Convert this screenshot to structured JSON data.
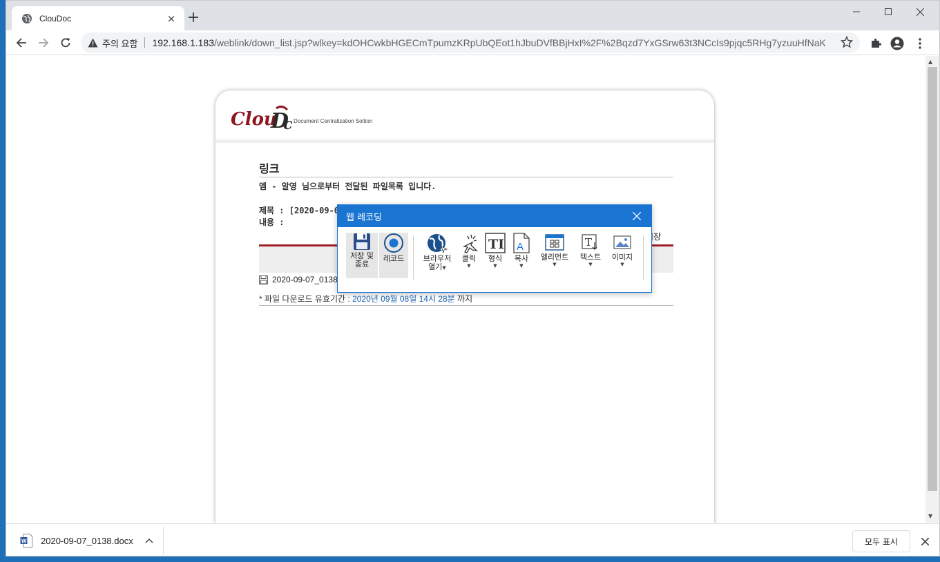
{
  "browser": {
    "tab_title": "ClouDoc",
    "tab_close": "×",
    "new_tab": "+",
    "security_warning": "주의 요함",
    "url_host": "192.168.1.183",
    "url_path": "/weblink/down_list.jsp?wlkey=kdOHCwkbHGECmTpumzKRpUbQEot1hJbuDVfBBjHxI%2F%2Bqzd7YxGSrw63t3NCcIs9pjqc5RHg7yzuuHfNaK..."
  },
  "page": {
    "logo_sub": "Document Centralization Soltion",
    "title": "링크",
    "subtitle": "엠 - 알영 님으로부터 전달된 파일목록 입니다.",
    "subject_label": "제목 : [2020-09-07",
    "content_label": "내용 :",
    "save_fragment": "저장",
    "file_name": "2020-09-07_0138.",
    "expire_prefix": "* 파일 다운로드 유효기간 : ",
    "expire_date": "2020년 09월 08일 14시 28분",
    "expire_suffix": " 까지"
  },
  "recorder": {
    "title": "웹 레코딩",
    "buttons": [
      {
        "line1": "저장 및",
        "line2": "종료",
        "icon": "floppy-disk-icon"
      },
      {
        "line1": "레코드",
        "line2": "",
        "icon": "record-icon"
      },
      {
        "line1": "브라우저",
        "line2": "열기",
        "icon": "globe-icon"
      },
      {
        "line1": "클릭",
        "line2": "",
        "icon": "click-icon"
      },
      {
        "line1": "형식",
        "line2": "",
        "icon": "text-format-icon"
      },
      {
        "line1": "복사",
        "line2": "",
        "icon": "copy-icon"
      },
      {
        "line1": "엘리먼트",
        "line2": "",
        "icon": "element-icon"
      },
      {
        "line1": "텍스트",
        "line2": "",
        "icon": "text-icon"
      },
      {
        "line1": "이미지",
        "line2": "",
        "icon": "image-icon"
      }
    ],
    "accent": "#1a75d2"
  },
  "downloads": {
    "file_name": "2020-09-07_0138.docx",
    "show_all": "모두 표시"
  },
  "colors": {
    "brand_red": "#a11d24",
    "link_blue": "#1a63b0"
  }
}
